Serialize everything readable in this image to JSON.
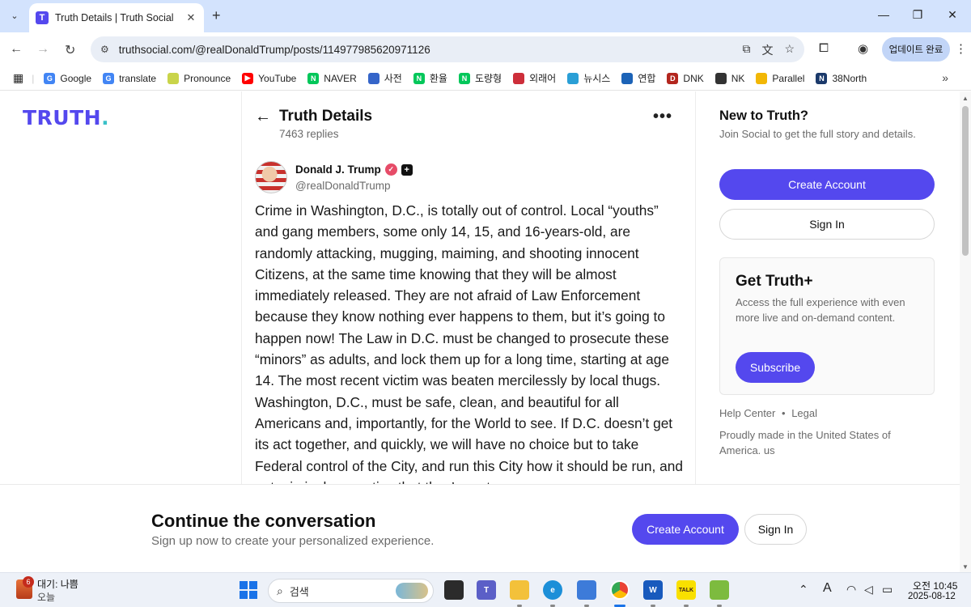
{
  "browser": {
    "tab": {
      "title": "Truth Details | Truth Social",
      "favicon_letter": "T"
    },
    "url": "truthsocial.com/@realDonaldTrump/posts/114977985620971126",
    "update_label": "업데이트 완료",
    "bookmarks": [
      {
        "label": "Google",
        "icon": "google-icon",
        "color": "#4285f4",
        "glyph": "G"
      },
      {
        "label": "translate",
        "icon": "google-icon",
        "color": "#4285f4",
        "glyph": "G"
      },
      {
        "label": "Pronounce",
        "icon": "pronounce-icon",
        "color": "#c9d44a",
        "glyph": ""
      },
      {
        "label": "YouTube",
        "icon": "youtube-icon",
        "color": "#ff0000",
        "glyph": "▶"
      },
      {
        "label": "NAVER",
        "icon": "naver-icon",
        "color": "#03c75a",
        "glyph": "N"
      },
      {
        "label": "사전",
        "icon": "dictionary-icon",
        "color": "#3565c9",
        "glyph": ""
      },
      {
        "label": "환율",
        "icon": "naver-icon",
        "color": "#03c75a",
        "glyph": "N"
      },
      {
        "label": "도량형",
        "icon": "naver-icon",
        "color": "#03c75a",
        "glyph": "N"
      },
      {
        "label": "외래어",
        "icon": "korea-flag-icon",
        "color": "#cd2e3a",
        "glyph": ""
      },
      {
        "label": "뉴시스",
        "icon": "newsis-icon",
        "color": "#2a9fd6",
        "glyph": ""
      },
      {
        "label": "연합",
        "icon": "yonhap-icon",
        "color": "#1c63b7",
        "glyph": ""
      },
      {
        "label": "DNK",
        "icon": "dnk-icon",
        "color": "#b3261e",
        "glyph": "D"
      },
      {
        "label": "NK",
        "icon": "nk-icon",
        "color": "#333333",
        "glyph": ""
      },
      {
        "label": "Parallel",
        "icon": "parallel-icon",
        "color": "#f2b705",
        "glyph": ""
      },
      {
        "label": "38North",
        "icon": "38north-icon",
        "color": "#1b3a6b",
        "glyph": "N"
      }
    ]
  },
  "page": {
    "logo_text": "TRUTH",
    "logo_dot": ".",
    "header": {
      "title": "Truth Details",
      "replies": "7463 replies"
    },
    "post": {
      "author": "Donald J. Trump",
      "handle": "@realDonaldTrump",
      "text": "Crime in Washington, D.C., is totally out of control. Local “youths” and gang members, some only 14, 15, and 16-years-old, are randomly attacking, mugging, maiming, and shooting innocent Citizens, at the same time knowing that they will be almost immediately released. They are not afraid of Law Enforcement because they know nothing ever happens to them, but it’s going to happen now! The Law in D.C. must be changed to prosecute these “minors” as adults, and lock them up for a long time, starting at age 14. The most recent victim was beaten mercilessly by local thugs. Washington, D.C., must be safe, clean, and beautiful for all Americans and, importantly, for the World to see. If D.C. doesn’t get its act together, and quickly, we will have no choice but to take Federal control of the City, and run this City how it should be run, and put criminals on notice that they’re not"
    },
    "sidebar": {
      "new_title": "New to Truth?",
      "new_sub": "Join Social to get the full story and details.",
      "create_account": "Create Account",
      "sign_in": "Sign In",
      "plus_title": "Get Truth+",
      "plus_sub": "Access the full experience with even more live and on-demand content.",
      "subscribe": "Subscribe",
      "help_center": "Help Center",
      "separator": "•",
      "legal": "Legal",
      "made_in": "Proudly made in the United States of America. us"
    },
    "cta": {
      "title": "Continue the conversation",
      "sub": "Sign up now to create your personalized experience.",
      "create_account": "Create Account",
      "sign_in": "Sign In"
    }
  },
  "taskbar": {
    "weather_badge": "6",
    "weather_line1": "대기: 나쁨",
    "weather_line2": "오늘",
    "search_placeholder": "검색",
    "time": "오전 10:45",
    "date": "2025-08-12",
    "ime": "A"
  },
  "colors": {
    "brand": "#5448ee",
    "tabbar": "#d3e3fd"
  }
}
